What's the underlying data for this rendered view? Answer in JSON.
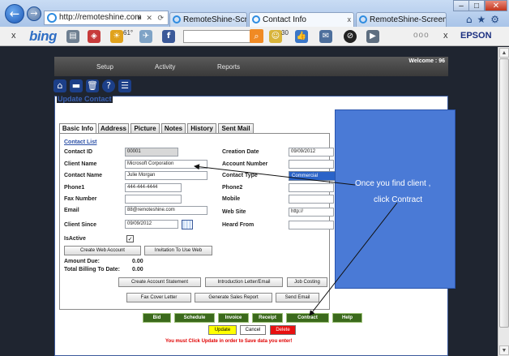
{
  "browser": {
    "url": "http://remoteshine.com",
    "tabs": [
      {
        "label": "RemoteShine-Screen Shots",
        "active": false
      },
      {
        "label": "Contact Info",
        "active": true
      },
      {
        "label": "RemoteShine-Screen Shots",
        "active": false
      }
    ],
    "window_controls": [
      "–",
      "□",
      "✕"
    ],
    "toolbar": {
      "close": "x",
      "brand": "bing",
      "weather": "61°",
      "count": "30",
      "more": "ooo",
      "close2": "x",
      "printer": "EPSON"
    }
  },
  "app": {
    "menu": [
      "Setup",
      "Activity",
      "Reports"
    ],
    "welcome": "Welcome : 96",
    "panel_title": "Update Contact",
    "tabs": [
      "Basic Info",
      "Address",
      "Picture",
      "Notes",
      "History",
      "Sent Mail"
    ],
    "active_tab": "Basic Info",
    "contact_list_link": "Contact List",
    "labels": {
      "contact_id": "Contact ID",
      "client_name": "Client Name",
      "contact_name": "Contact Name",
      "phone1": "Phone1",
      "fax_number": "Fax Number",
      "email": "Email",
      "client_since": "Client Since",
      "is_active": "IsActive",
      "creation_date": "Creation Date",
      "account_number": "Account Number",
      "contact_type": "Contact Type",
      "phone2": "Phone2",
      "mobile": "Mobile",
      "web_site": "Web Site",
      "heard_from": "Heard From",
      "amount_due": "Amount Due:",
      "total_billing": "Total Billing To Date:"
    },
    "values": {
      "contact_id": "00001",
      "client_name": "Microsoft Corporation",
      "contact_name": "Julie Morgan",
      "phone1": "444-444-4444",
      "fax_number": "",
      "email": "88@remoteshine.com",
      "client_since": "09/09/2012",
      "is_active_mark": "✓",
      "creation_date": "09/09/2012",
      "account_number": "",
      "contact_type": "Commercial",
      "phone2": "",
      "mobile": "",
      "web_site": "http://",
      "heard_from": "",
      "amount_due": "0.00",
      "total_billing": "0.00"
    },
    "buttons": {
      "create_web_account": "Create Web Account",
      "invitation": "Invitation To Use Web",
      "create_account_statement": "Create Account Statement",
      "introduction_letter": "Introduction Letter/Email",
      "job_costing": "Job Costing",
      "fax_cover_letter": "Fax Cover Letter",
      "generate_sales_report": "Generate Sales Report",
      "send_email": "Send Email"
    },
    "action_bar": [
      "Bid",
      "Schedule",
      "Invoice",
      "Receipt",
      "Contract",
      "Help"
    ],
    "form_actions": {
      "update": "Update",
      "cancel": "Cancel",
      "delete": "Delete"
    },
    "warning": "You must Click Update in order to Save data you enter!",
    "colors": {
      "update": "#ffff00",
      "delete": "#e81010",
      "action_green": "#3b6a1c",
      "warning": "#e00000"
    }
  },
  "annotation": {
    "line1": "Once you find client ,",
    "line2": "click Contract",
    "color": "#4a7ad6"
  }
}
